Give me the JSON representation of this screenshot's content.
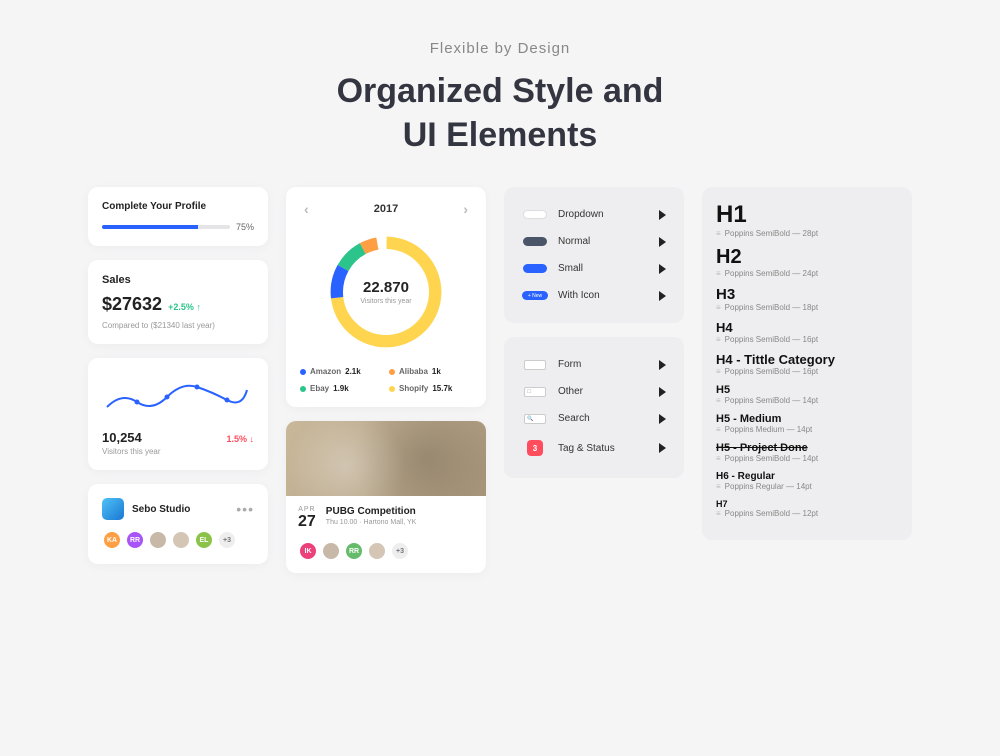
{
  "header": {
    "eyebrow": "Flexible by Design",
    "title_line1": "Organized Style and",
    "title_line2": "UI Elements"
  },
  "profile": {
    "title": "Complete Your Profile",
    "percent": "75%"
  },
  "sales": {
    "label": "Sales",
    "value": "$27632",
    "delta": "+2.5% ↑",
    "compared": "Compared to ($21340 last year)"
  },
  "visitors_chart": {
    "value": "10,254",
    "label": "Visitors this year",
    "delta": "1.5% ↓"
  },
  "sebo": {
    "name": "Sebo Studio",
    "more": "+3",
    "avatars": [
      {
        "label": "KA",
        "color": "#ff9f43"
      },
      {
        "label": "RR",
        "color": "#a855f7"
      },
      {
        "label": "",
        "color": "#c8b8a8"
      },
      {
        "label": "",
        "color": "#d4c5b5"
      },
      {
        "label": "EL",
        "color": "#8bc34a"
      }
    ]
  },
  "donut": {
    "year": "2017",
    "value": "22.870",
    "label": "Visitors this year",
    "legend": [
      {
        "name": "Amazon",
        "value": "2.1k",
        "color": "#2962ff"
      },
      {
        "name": "Alibaba",
        "value": "1k",
        "color": "#ff9f43"
      },
      {
        "name": "Ebay",
        "value": "1.9k",
        "color": "#2bc48a"
      },
      {
        "name": "Shopify",
        "value": "15.7k",
        "color": "#ffd54f"
      }
    ]
  },
  "event": {
    "month": "APR",
    "day": "27",
    "title": "PUBG Competition",
    "sub": "Thu 10.00 · Hartono Mall, YK",
    "more": "+3",
    "avatars": [
      {
        "label": "IK",
        "color": "#ec407a"
      },
      {
        "label": "",
        "color": "#c8b8a8"
      },
      {
        "label": "RR",
        "color": "#66bb6a"
      },
      {
        "label": "",
        "color": "#d4c5b5"
      }
    ]
  },
  "buttons_panel": {
    "items": [
      {
        "label": "Dropdown"
      },
      {
        "label": "Normal"
      },
      {
        "label": "Small"
      },
      {
        "label": "With Icon"
      }
    ]
  },
  "inputs_panel": {
    "items": [
      {
        "label": "Form"
      },
      {
        "label": "Other"
      },
      {
        "label": "Search"
      },
      {
        "label": "Tag & Status",
        "badge": "3"
      }
    ]
  },
  "typography": [
    {
      "heading": "H1",
      "class": "h1",
      "meta": "Poppins SemiBold — 28pt"
    },
    {
      "heading": "H2",
      "class": "h2",
      "meta": "Poppins SemiBold — 24pt"
    },
    {
      "heading": "H3",
      "class": "h3",
      "meta": "Poppins SemiBold — 18pt"
    },
    {
      "heading": "H4",
      "class": "h4",
      "meta": "Poppins SemiBold — 16pt"
    },
    {
      "heading": "H4 - Tittle Category",
      "class": "h4",
      "meta": "Poppins SemiBold — 16pt"
    },
    {
      "heading": "H5",
      "class": "h5",
      "meta": "Poppins SemiBold — 14pt"
    },
    {
      "heading": "H5 - Medium",
      "class": "h5",
      "meta": "Poppins Medium — 14pt"
    },
    {
      "heading": "H5 - Project Done",
      "class": "h5 strike",
      "meta": "Poppins SemiBold — 14pt"
    },
    {
      "heading": "H6 - Regular",
      "class": "h6",
      "meta": "Poppins Regular — 14pt"
    },
    {
      "heading": "H7",
      "class": "h7",
      "meta": "Poppins SemiBold — 12pt"
    }
  ]
}
